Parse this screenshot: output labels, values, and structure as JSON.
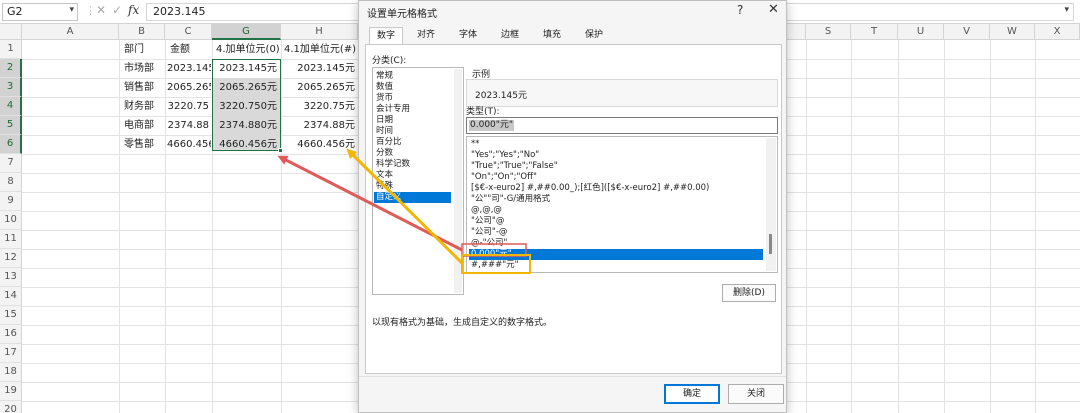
{
  "formula_bar": {
    "name_box": "G2",
    "cancel_glyph": "✕",
    "enter_glyph": "✓",
    "fx_label": "fx",
    "content": "2023.145"
  },
  "columns": [
    "A",
    "B",
    "C",
    "G",
    "H",
    "S",
    "T",
    "U",
    "V",
    "W",
    "X"
  ],
  "rows": [
    "1",
    "2",
    "3",
    "4",
    "5",
    "6",
    "7",
    "8",
    "9",
    "10",
    "11",
    "12",
    "13",
    "14",
    "15",
    "16",
    "17",
    "18",
    "19",
    "20"
  ],
  "table": {
    "headers": [
      "部门",
      "金额",
      "4.加单位元(0)",
      "4.1加单位元(#)"
    ],
    "rows": [
      [
        "市场部",
        "2023.145",
        "2023.145元",
        "2023.145元"
      ],
      [
        "销售部",
        "2065.265",
        "2065.265元",
        "2065.265元"
      ],
      [
        "财务部",
        "3220.75",
        "3220.750元",
        "3220.75元"
      ],
      [
        "电商部",
        "2374.88",
        "2374.880元",
        "2374.88元"
      ],
      [
        "零售部",
        "4660.456",
        "4660.456元",
        "4660.456元"
      ]
    ]
  },
  "dialog": {
    "title": "设置单元格格式",
    "help": "?",
    "close": "✕",
    "tabs": [
      "数字",
      "对齐",
      "字体",
      "边框",
      "填充",
      "保护"
    ],
    "active_tab": "数字",
    "category_label": "分类(C):",
    "categories": [
      "常规",
      "数值",
      "货币",
      "会计专用",
      "日期",
      "时间",
      "百分比",
      "分数",
      "科学记数",
      "文本",
      "特殊",
      "自定义"
    ],
    "selected_category": "自定义",
    "sample_label": "示例",
    "sample_value": "2023.145元",
    "type_label": "类型(T):",
    "type_value": "0.000\"元\"",
    "formats": [
      "**",
      "\"Yes\";\"Yes\";\"No\"",
      "\"True\";\"True\";\"False\"",
      "\"On\";\"On\";\"Off\"",
      "[$€-x-euro2] #,##0.00_);[红色]([$€-x-euro2] #,##0.00)",
      "\"公\"\"司\"-G/通用格式",
      "@,@,@",
      "\"公司\"@",
      "\"公司\"-@",
      "@-\"公司\"",
      "0.000\"元\"",
      "#,###\"元\""
    ],
    "selected_format": "0.000\"元\"",
    "delete_label": "删除(D)",
    "description": "以现有格式为基础，生成自定义的数字格式。",
    "ok_label": "确定",
    "cancel_label": "关闭"
  },
  "colors": {
    "excel_green": "#217346",
    "selection_blue": "#0078d7",
    "arrow_red": "#e05a5a",
    "arrow_yellow": "#f2b705"
  }
}
